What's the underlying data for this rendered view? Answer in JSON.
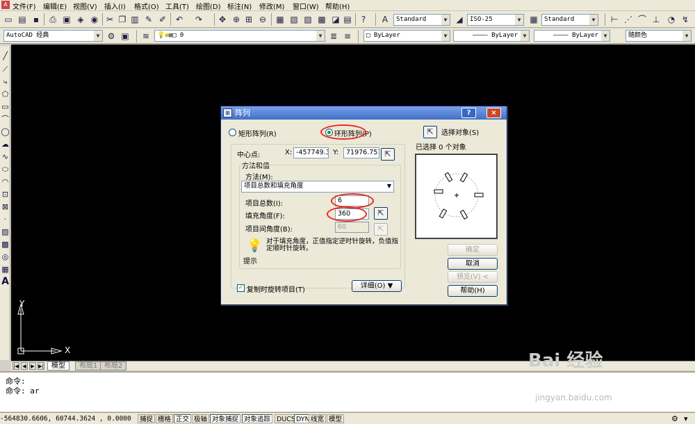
{
  "menubar": {
    "items": [
      "文件(F)",
      "编辑(E)",
      "视图(V)",
      "插入(I)",
      "格式(O)",
      "工具(T)",
      "绘图(D)",
      "标注(N)",
      "修改(M)",
      "窗口(W)",
      "帮助(H)"
    ]
  },
  "toolbar": {
    "text_style": "Standard",
    "dim_style": "ISO-25",
    "table_style": "Standard",
    "workspace": "AutoCAD 经典",
    "layer": "0",
    "color": "ByLayer",
    "linetype": "ByLayer",
    "lineweight": "ByLayer",
    "plotstyle": "随颜色"
  },
  "canvas": {
    "ucs_y": "Y",
    "ucs_x": "X"
  },
  "tabs": {
    "model": "模型",
    "layout1": "布局1",
    "layout2": "布局2"
  },
  "command": {
    "line1": "命令:",
    "line2": "命令: ar"
  },
  "status": {
    "coords": "-564830.6606, 60744.3624 , 0.0000",
    "buttons": [
      "捕捉",
      "栅格",
      "正交",
      "极轴",
      "对象捕捉",
      "对象追踪",
      "DUCS",
      "DYN",
      "线宽",
      "模型"
    ]
  },
  "dialog": {
    "title": "阵列",
    "help_btn": "?",
    "close_btn": "×",
    "rect_array": "矩形阵列(R)",
    "polar_array": "环形阵列(P)",
    "select_objects": "选择对象(S)",
    "selected_count": "已选择 0 个对象",
    "center_label": "中心点:",
    "x_label": "X:",
    "x_value": "-457749.3",
    "y_label": "Y:",
    "y_value": "71976.751",
    "method_group": "方法和值",
    "method_label": "方法(M):",
    "method_value": "项目总数和填充角度",
    "total_items_label": "项目总数(I):",
    "total_items_value": "6",
    "fill_angle_label": "填充角度(F):",
    "fill_angle_value": "360",
    "angle_between_label": "项目间角度(B):",
    "angle_between_value": "60",
    "tip_text": "对于填充角度，正值指定逆时针旋转，负值指定顺时针旋转。",
    "tip_label": "提示",
    "rotate_label": "复制时旋转项目(T)",
    "details_btn": "详细(O) ▼",
    "ok_btn": "确定",
    "cancel_btn": "取消",
    "preview_btn": "预览(V) <",
    "help_btn2": "帮助(H)"
  },
  "watermark": {
    "text": "Bai 经验",
    "url": "jingyan.baidu.com"
  }
}
